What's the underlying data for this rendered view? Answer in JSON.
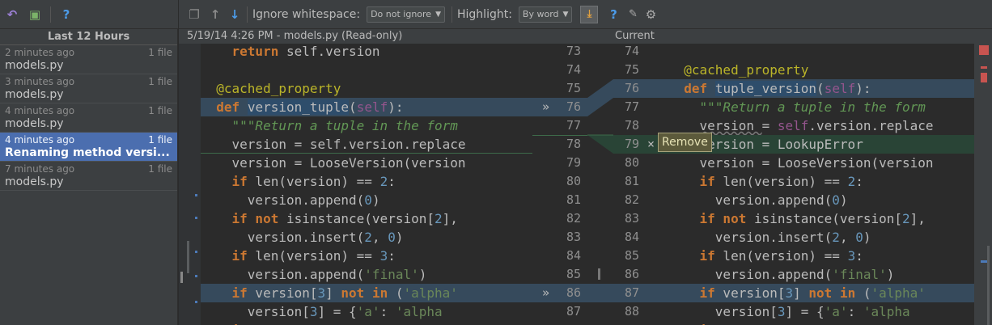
{
  "toolbar_left": {
    "undo_icon": "undo-icon",
    "revert_icon": "revert-icon",
    "help": "?"
  },
  "history": {
    "title": "Last 12 Hours",
    "items": [
      {
        "time": "2 minutes ago",
        "count": "1 file",
        "file": "models.py"
      },
      {
        "time": "3 minutes ago",
        "count": "1 file",
        "file": "models.py"
      },
      {
        "time": "4 minutes ago",
        "count": "1 file",
        "file": "models.py"
      },
      {
        "time": "4 minutes ago",
        "count": "1 file",
        "file": "Renaming method versi..."
      },
      {
        "time": "7 minutes ago",
        "count": "1 file",
        "file": "models.py"
      }
    ]
  },
  "diff_toolbar": {
    "ignore_label": "Ignore whitespace:",
    "ignore_value": "Do not ignore",
    "highlight_label": "Highlight:",
    "highlight_value": "By word",
    "help": "?"
  },
  "left_header": "5/19/14 4:26 PM - models.py (Read-only)",
  "right_header": "Current",
  "left_numbers": [
    "73",
    "74",
    "75",
    "76",
    "77",
    "78",
    "79",
    "80",
    "81",
    "82",
    "83",
    "84",
    "85",
    "86",
    "87"
  ],
  "right_numbers": [
    "74",
    "75",
    "76",
    "77",
    "78",
    "79",
    "80",
    "81",
    "82",
    "83",
    "84",
    "85",
    "86",
    "87",
    "88"
  ],
  "popup": "Remove",
  "arrow": "»",
  "colors": {
    "accent": "#4b6eaf",
    "changed": "#364a5c",
    "inserted": "#294436"
  }
}
